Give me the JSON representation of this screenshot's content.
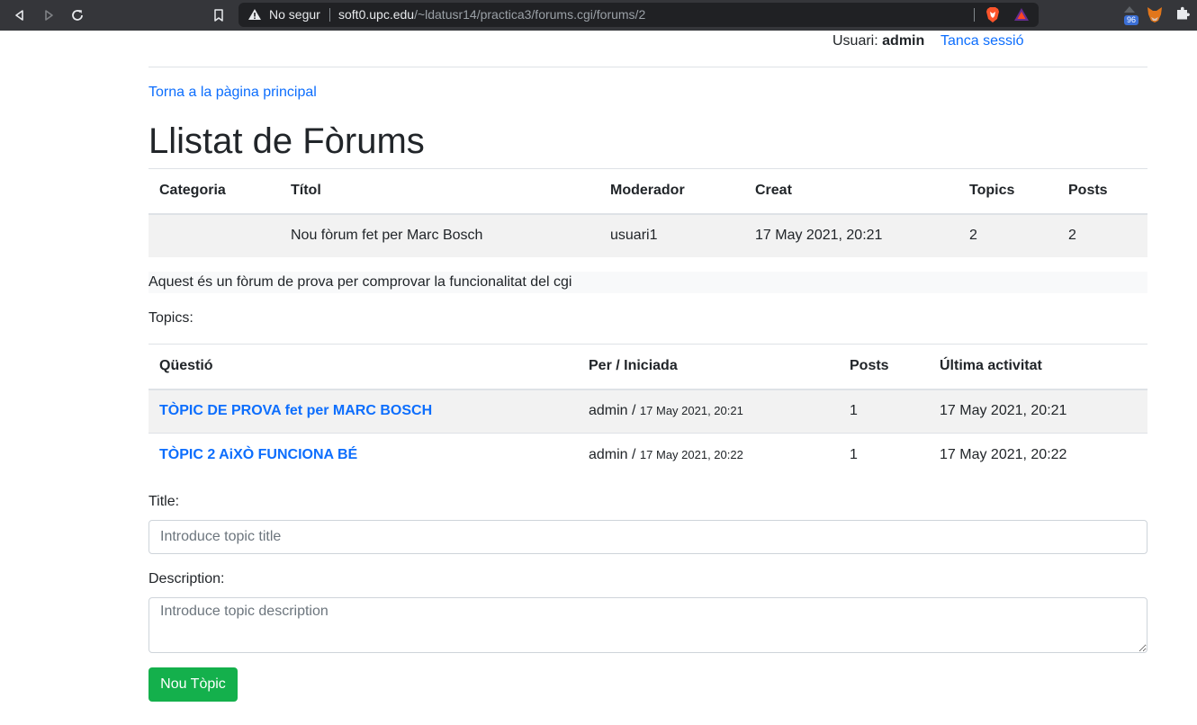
{
  "browser": {
    "security_label": "No segur",
    "url_host": "soft0.upc.edu",
    "url_path": "/~ldatusr14/practica3/forums.cgi/forums/2",
    "extension_badge": "96"
  },
  "header": {
    "user_prefix": "Usuari:",
    "username": "admin",
    "logout_label": "Tanca sessió"
  },
  "back_link": "Torna a la pàgina principal",
  "page_title": "Llistat de Fòrums",
  "forums_table": {
    "headers": [
      "Categoria",
      "Títol",
      "Moderador",
      "Creat",
      "Topics",
      "Posts"
    ],
    "rows": [
      {
        "category": "",
        "title": "Nou fòrum fet per Marc Bosch",
        "moderator": "usuari1",
        "created": "17 May 2021, 20:21",
        "topics": "2",
        "posts": "2"
      }
    ]
  },
  "forum_description": "Aquest és un fòrum de prova per comprovar la funcionalitat del cgi",
  "topics_label": "Topics:",
  "topics_table": {
    "headers": [
      "Qüestió",
      "Per / Iniciada",
      "Posts",
      "Última activitat"
    ],
    "rows": [
      {
        "question": "TÒPIC DE PROVA fet per MARC BOSCH",
        "author": "admin",
        "sep": " / ",
        "started": "17 May 2021, 20:21",
        "posts": "1",
        "last_activity": "17 May 2021, 20:21"
      },
      {
        "question": "TÒPIC 2 AiXÒ FUNCIONA BÉ",
        "author": "admin",
        "sep": " / ",
        "started": "17 May 2021, 20:22",
        "posts": "1",
        "last_activity": "17 May 2021, 20:22"
      }
    ]
  },
  "form": {
    "title_label": "Title:",
    "title_placeholder": "Introduce topic title",
    "description_label": "Description:",
    "description_placeholder": "Introduce topic description",
    "submit_label": "Nou Tòpic"
  },
  "colors": {
    "link": "#0d6efd",
    "submit": "#14b04c",
    "chrome": "#35363a"
  }
}
